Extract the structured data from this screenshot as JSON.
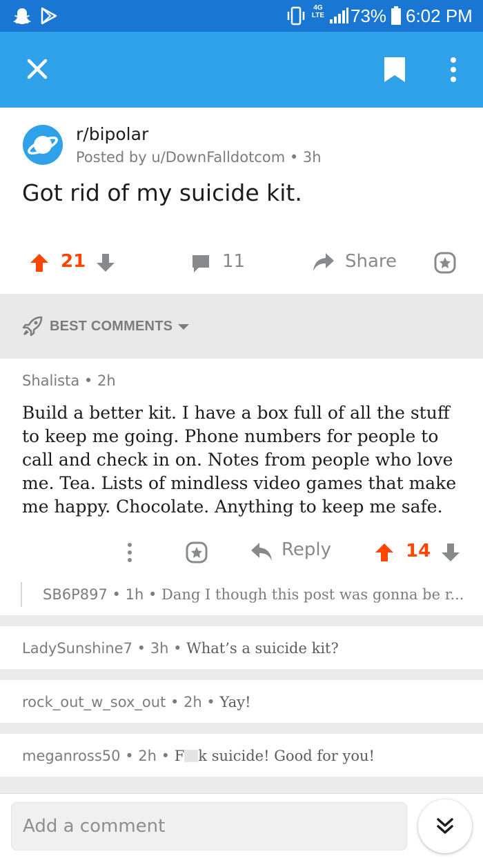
{
  "status_bar": {
    "signal_label": "4G LTE",
    "battery": "73%",
    "time": "6:02 PM"
  },
  "app_bar": {
    "close_icon": "close-icon",
    "bookmark_icon": "bookmark-icon",
    "more_icon": "more-vertical-icon"
  },
  "post": {
    "subreddit": "r/bipolar",
    "posted_by_prefix": "Posted by",
    "author": "u/DownFalldotcom",
    "age": "3h",
    "title": "Got rid of my suicide kit.",
    "score": "21",
    "comment_count": "11",
    "share_label": "Share"
  },
  "sort": {
    "label": "BEST COMMENTS"
  },
  "comments": [
    {
      "author": "Shalista",
      "age": "2h",
      "body": "Build a better kit. I have a box full of all the stuff to keep me going. Phone numbers for people to call and check in on. Notes from people who love me. Tea. Lists of mindless video games that make me happy. Chocolate. Anything to keep me safe.",
      "reply_label": "Reply",
      "score": "14",
      "reply": {
        "author": "SB6P897",
        "age": "1h",
        "preview": "Dang I though this post was gonna be r..."
      }
    },
    {
      "author": "LadySunshine7",
      "age": "3h",
      "preview": "What’s a suicide kit?"
    },
    {
      "author": "rock_out_w_sox_out",
      "age": "2h",
      "preview": "Yay!"
    },
    {
      "author": "meganross50",
      "age": "2h",
      "preview_start": "F",
      "preview_end": "k suicide! Good for you!"
    }
  ],
  "composer": {
    "placeholder": "Add a comment"
  },
  "colors": {
    "status_bar": "#1976d2",
    "app_bar": "#2ea1e9",
    "upvote": "#ff4500",
    "muted": "#878a8c"
  }
}
